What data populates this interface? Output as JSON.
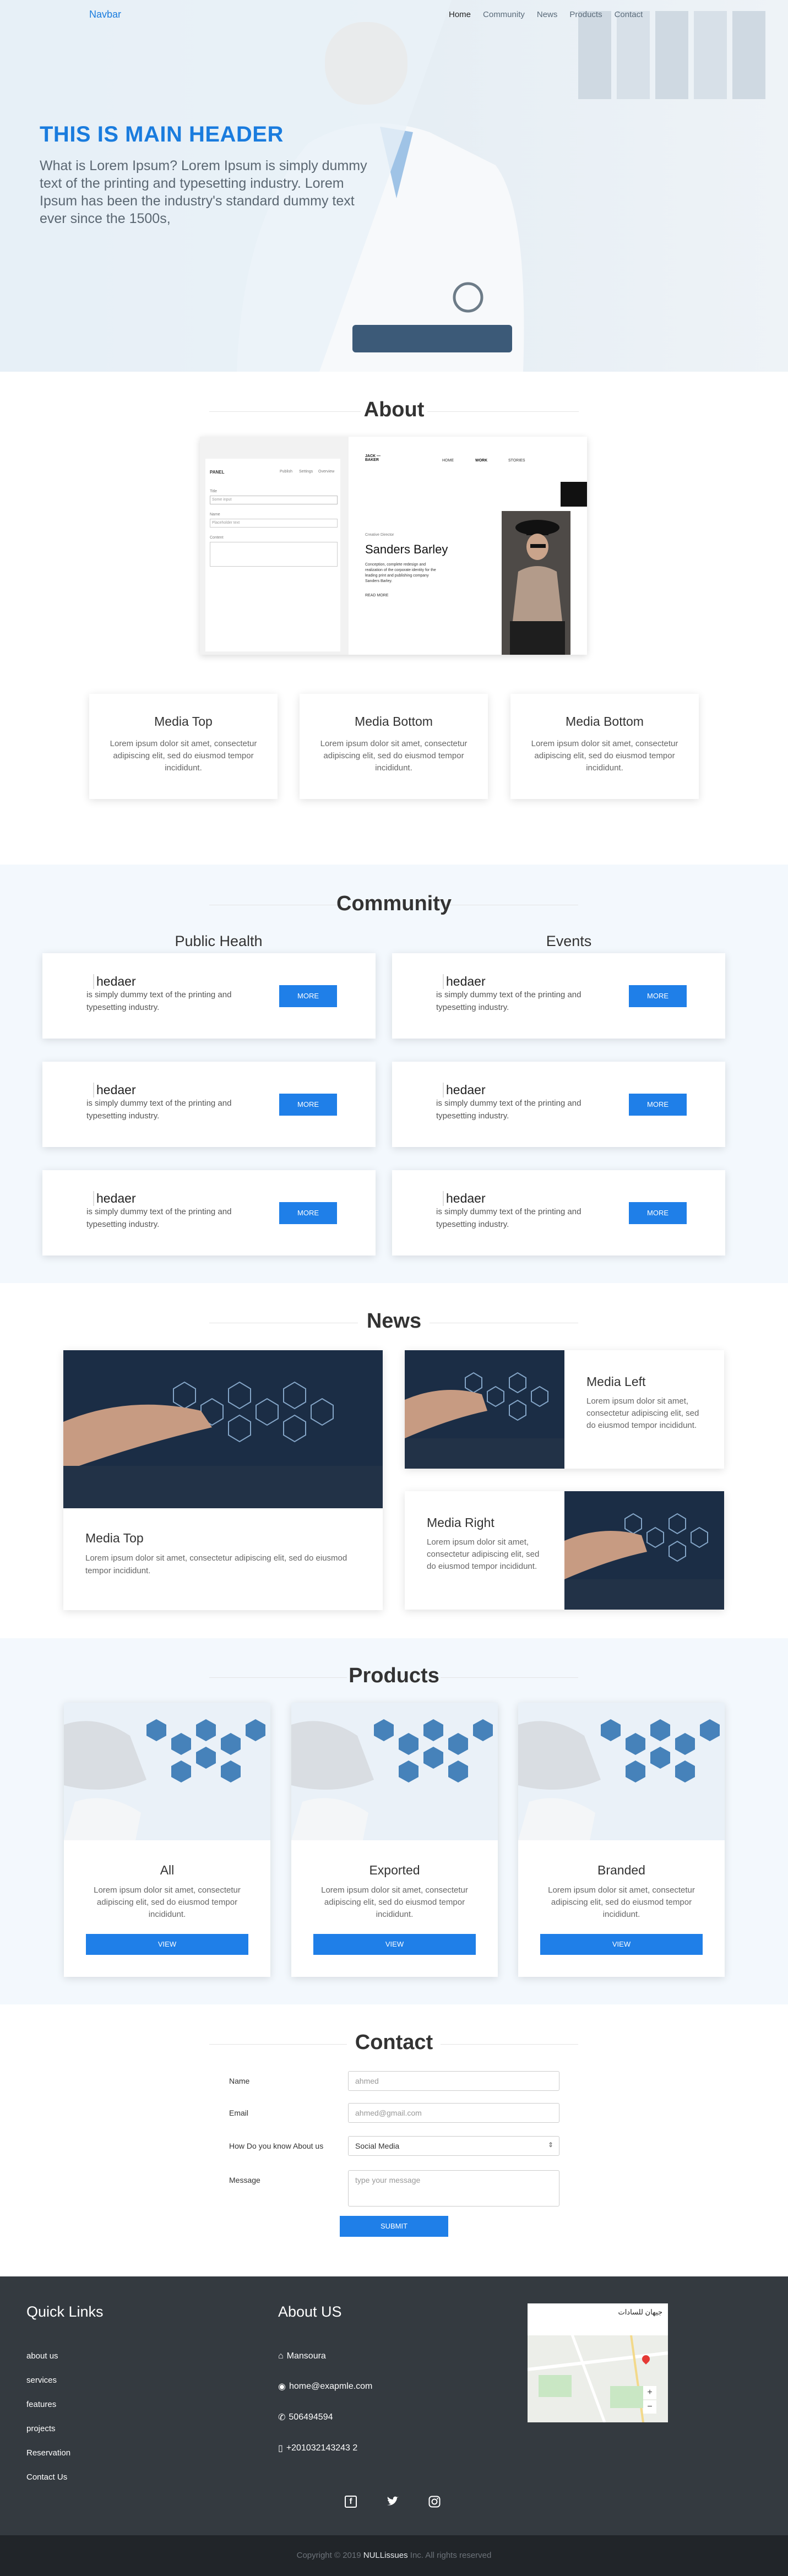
{
  "nav": {
    "brand": "Navbar",
    "links": [
      "Home",
      "Community",
      "News",
      "Products",
      "Contact"
    ]
  },
  "hero": {
    "title": "THIS IS MAIN HEADER",
    "subtitle": "What is Lorem Ipsum? Lorem Ipsum is simply dummy text of the printing and typesetting industry. Lorem Ipsum has been the industry's standard dummy text ever since the 1500s,"
  },
  "about": {
    "title": "About",
    "mockup": {
      "panel_label": "PANEL",
      "tabs": [
        "Publish",
        "Settings",
        "Overview"
      ],
      "title_label": "Title",
      "title_placeholder": "Some input",
      "name_label": "Name",
      "name_placeholder": "Placeholder text",
      "textarea_label": "Content",
      "jack_brand": "JACK — BAKER",
      "site_nav": [
        "HOME",
        "WORK",
        "STORIES"
      ],
      "person_role": "Creative Director",
      "person_name": "Sanders Barley",
      "person_text": "Conception, complete redesign and realization of the corporate identity for the leading print and publishing company Sanders Barley.",
      "read_more": "READ MORE"
    },
    "cards": [
      {
        "title": "Media Top",
        "text": "Lorem ipsum dolor sit amet, consectetur adipiscing elit, sed do eiusmod tempor incididunt."
      },
      {
        "title": "Media Bottom",
        "text": "Lorem ipsum dolor sit amet, consectetur adipiscing elit, sed do eiusmod tempor incididunt."
      },
      {
        "title": "Media Bottom",
        "text": "Lorem ipsum dolor sit amet, consectetur adipiscing elit, sed do eiusmod tempor incididunt."
      }
    ]
  },
  "community": {
    "title": "Community",
    "columns": [
      "Public Health",
      "Events"
    ],
    "card_title": "hedaer",
    "card_text": "is simply dummy text of the printing and typesetting industry.",
    "button": "MORE"
  },
  "news": {
    "title": "News",
    "top": {
      "title": "Media Top",
      "text": "Lorem ipsum dolor sit amet, consectetur adipiscing elit, sed do eiusmod tempor incididunt."
    },
    "left": {
      "title": "Media Left",
      "text": "Lorem ipsum dolor sit amet, consectetur adipiscing elit, sed do eiusmod tempor incididunt."
    },
    "right": {
      "title": "Media Right",
      "text": "Lorem ipsum dolor sit amet, consectetur adipiscing elit, sed do eiusmod tempor incididunt."
    }
  },
  "products": {
    "title": "Products",
    "items": [
      {
        "title": "All",
        "text": "Lorem ipsum dolor sit amet, consectetur adipiscing elit, sed do eiusmod tempor incididunt."
      },
      {
        "title": "Exported",
        "text": "Lorem ipsum dolor sit amet, consectetur adipiscing elit, sed do eiusmod tempor incididunt."
      },
      {
        "title": "Branded",
        "text": "Lorem ipsum dolor sit amet, consectetur adipiscing elit, sed do eiusmod tempor incididunt."
      }
    ],
    "button": "VIEW"
  },
  "contact": {
    "title": "Contact",
    "name_label": "Name",
    "name_placeholder": "ahmed",
    "email_label": "Email",
    "email_placeholder": "ahmed@gmail.com",
    "how_label": "How Do you know About us",
    "how_value": "Social Media",
    "message_label": "Message",
    "message_placeholder": "type your message",
    "submit": "SUBMIT"
  },
  "footer": {
    "quick_links_title": "Quick Links",
    "quick_links": [
      "about us",
      "services",
      "features",
      "projects",
      "Reservation",
      "Contact Us"
    ],
    "about_title": "About US",
    "address": "Mansoura",
    "email": "home@exapmle.com",
    "phone": "506494594",
    "mobile": "+201032143243 2",
    "map_place": "جيهان للسادات",
    "copyright_pre": "Copyright © 2019 ",
    "copyright_brand": "NULLissues",
    "copyright_post": " Inc. All rights reserved"
  },
  "colors": {
    "accent": "#1f7fe8",
    "footer_bg": "#343a40",
    "copyright_bg": "#212529",
    "section_bg": "#f3f8fd"
  }
}
